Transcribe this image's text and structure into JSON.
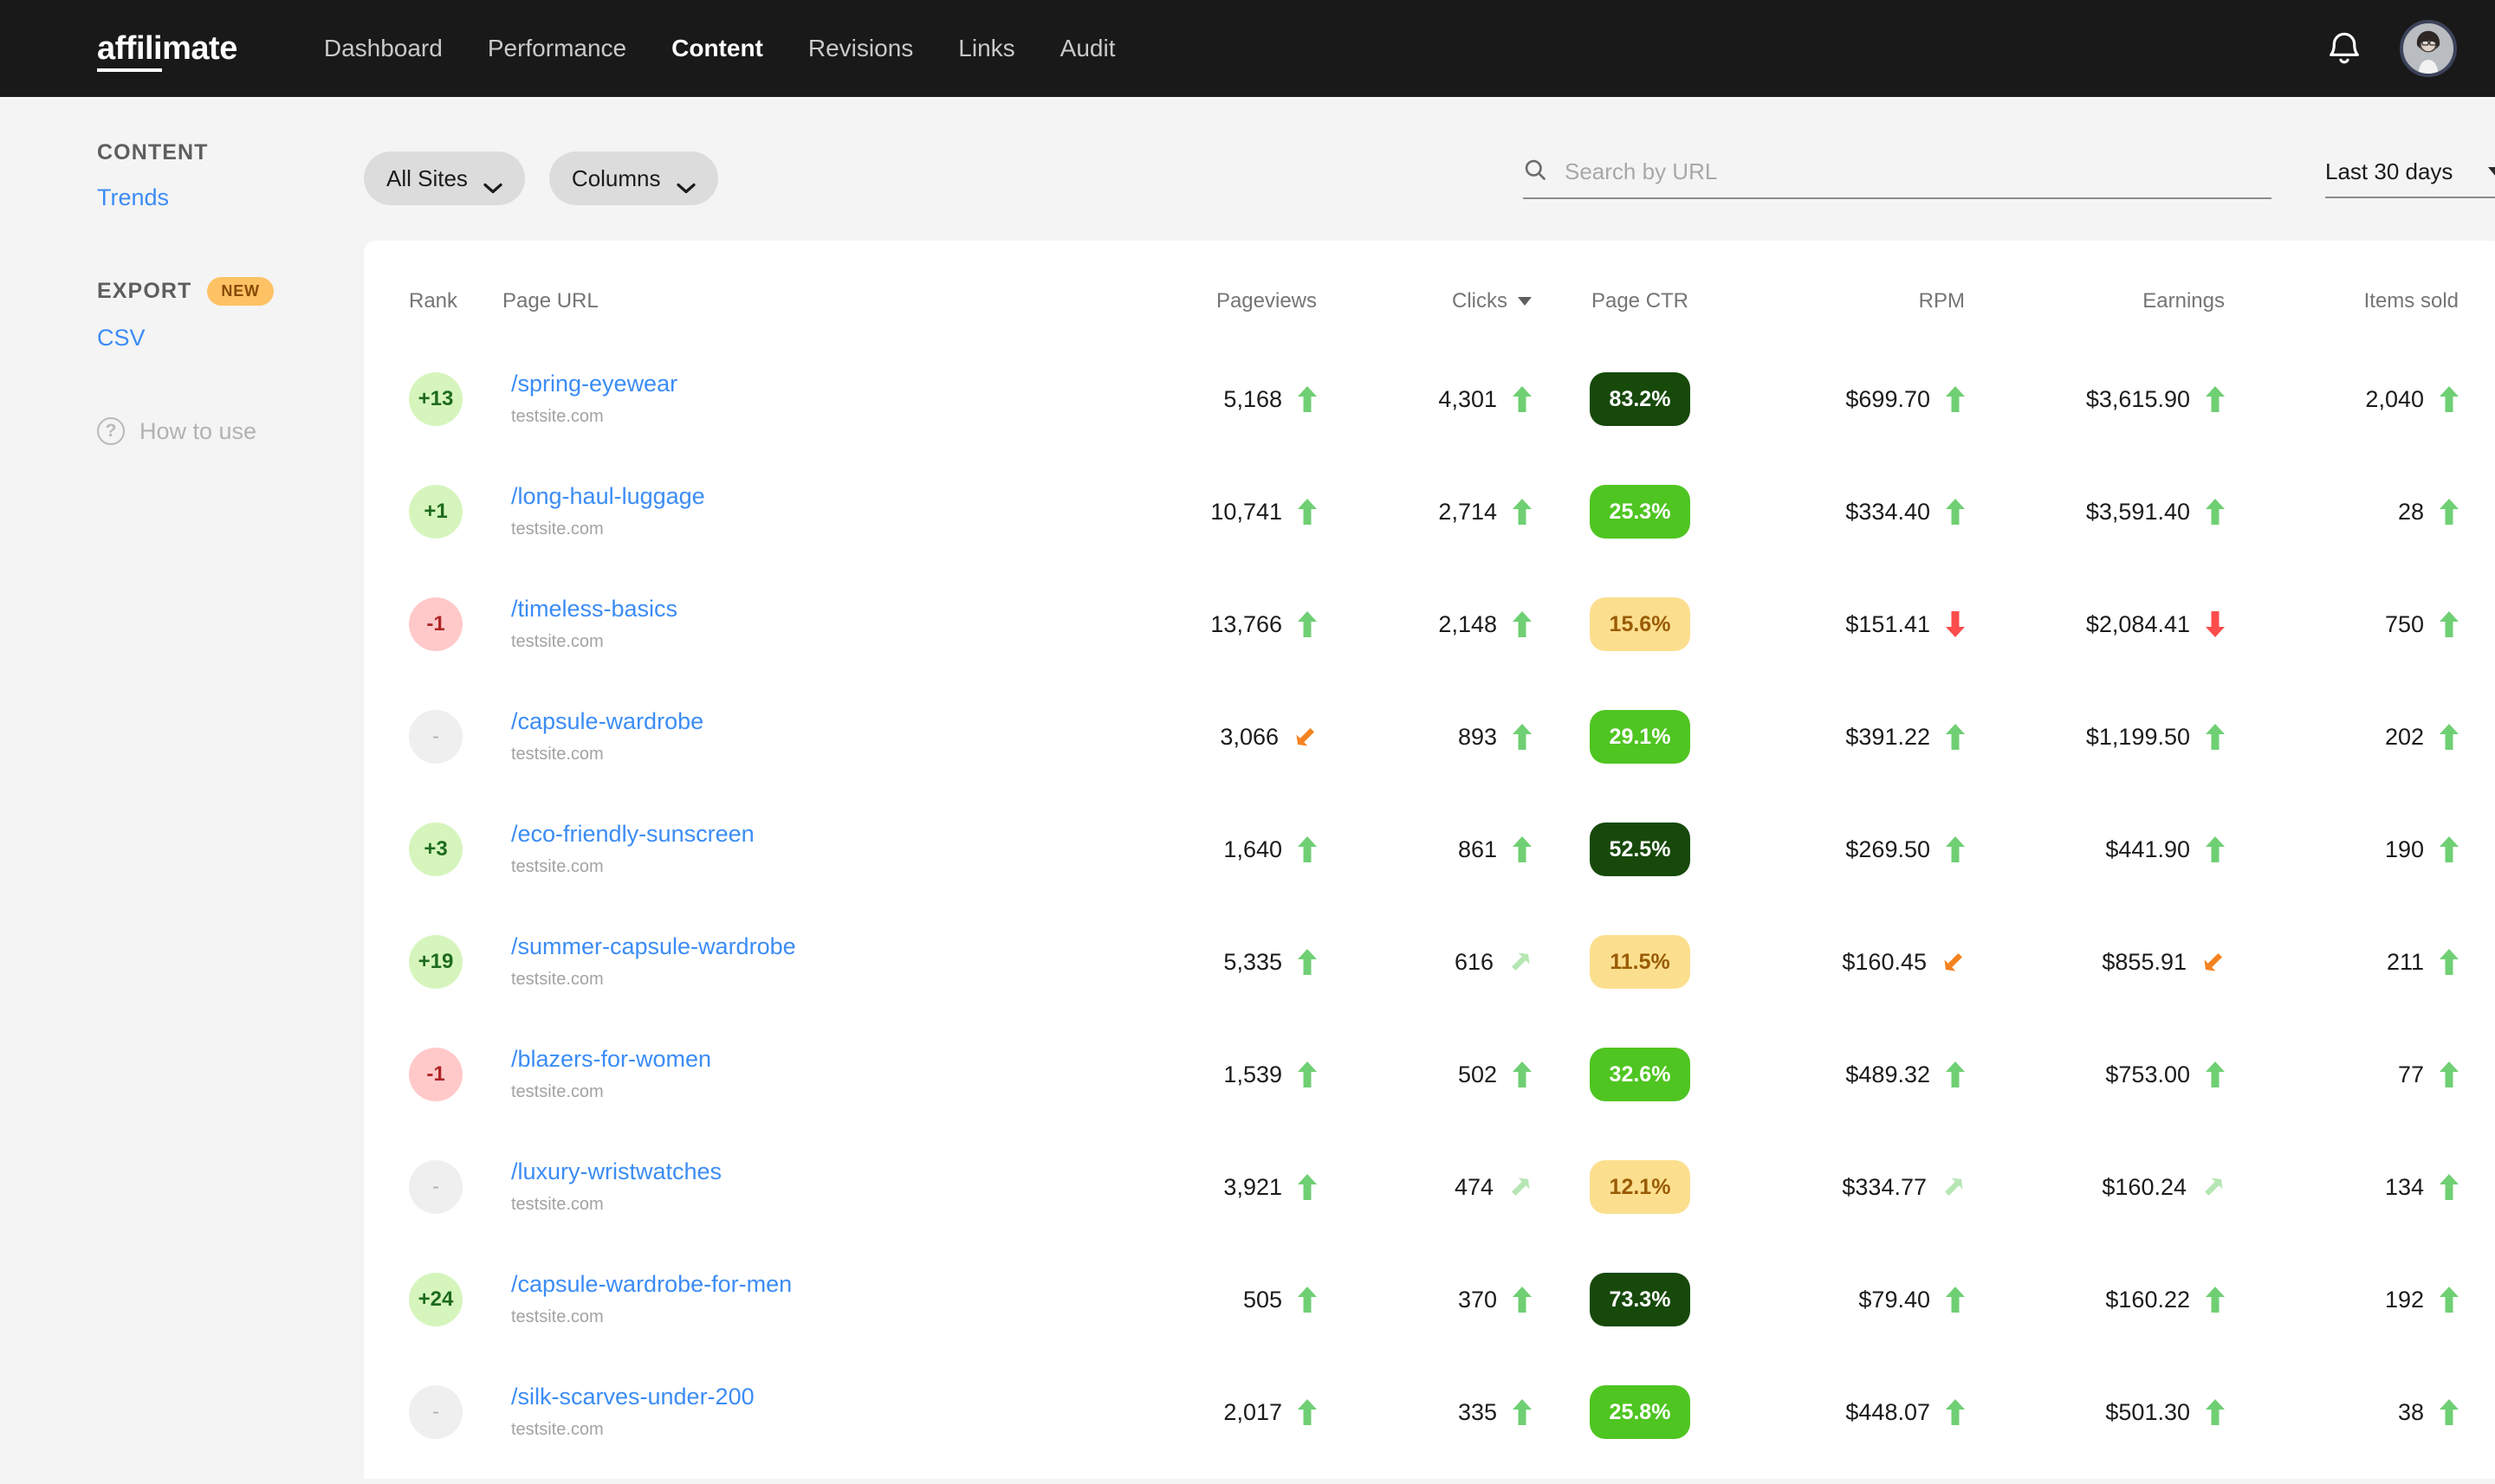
{
  "brand": {
    "name_underlined": "affili",
    "name_rest": "mate"
  },
  "nav": {
    "items": [
      {
        "label": "Dashboard",
        "active": false
      },
      {
        "label": "Performance",
        "active": false
      },
      {
        "label": "Content",
        "active": true
      },
      {
        "label": "Revisions",
        "active": false
      },
      {
        "label": "Links",
        "active": false
      },
      {
        "label": "Audit",
        "active": false
      }
    ],
    "notifications_icon": "bell-icon",
    "avatar_icon": "user-avatar"
  },
  "sidebar": {
    "section_content": "CONTENT",
    "content_links": [
      {
        "label": "Trends"
      }
    ],
    "section_export": "EXPORT",
    "export_badge": "NEW",
    "export_links": [
      {
        "label": "CSV"
      }
    ],
    "help": {
      "label": "How to use",
      "icon": "question-circle-icon"
    }
  },
  "toolbar": {
    "sites_filter": "All Sites",
    "columns_filter": "Columns",
    "search": {
      "value": "",
      "placeholder": "Search by URL",
      "icon": "search-icon"
    },
    "date_range": "Last 30 days"
  },
  "table": {
    "columns": [
      {
        "key": "rank",
        "label": "Rank",
        "sorted": false
      },
      {
        "key": "url",
        "label": "Page URL",
        "sorted": false
      },
      {
        "key": "pv",
        "label": "Pageviews",
        "sorted": false
      },
      {
        "key": "clicks",
        "label": "Clicks",
        "sorted": true
      },
      {
        "key": "ctr",
        "label": "Page CTR",
        "sorted": false
      },
      {
        "key": "rpm",
        "label": "RPM",
        "sorted": false
      },
      {
        "key": "earn",
        "label": "Earnings",
        "sorted": false
      },
      {
        "key": "items",
        "label": "Items sold",
        "sorted": false
      }
    ],
    "rows": [
      {
        "rank": "+13",
        "rank_state": "up",
        "url": "/spring-eyewear",
        "site": "testsite.com",
        "pageviews": "5,168",
        "pv_trend": "up",
        "clicks": "4,301",
        "clicks_trend": "up",
        "ctr": "83.2%",
        "ctr_level": "very-high",
        "rpm": "$699.70",
        "rpm_trend": "up",
        "earnings": "$3,615.90",
        "earn_trend": "up",
        "items": "2,040",
        "items_trend": "up"
      },
      {
        "rank": "+1",
        "rank_state": "up",
        "url": "/long-haul-luggage",
        "site": "testsite.com",
        "pageviews": "10,741",
        "pv_trend": "up",
        "clicks": "2,714",
        "clicks_trend": "up",
        "ctr": "25.3%",
        "ctr_level": "high",
        "rpm": "$334.40",
        "rpm_trend": "up",
        "earnings": "$3,591.40",
        "earn_trend": "up",
        "items": "28",
        "items_trend": "up"
      },
      {
        "rank": "-1",
        "rank_state": "down",
        "url": "/timeless-basics",
        "site": "testsite.com",
        "pageviews": "13,766",
        "pv_trend": "up",
        "clicks": "2,148",
        "clicks_trend": "up",
        "ctr": "15.6%",
        "ctr_level": "mid",
        "rpm": "$151.41",
        "rpm_trend": "down",
        "earnings": "$2,084.41",
        "earn_trend": "down",
        "items": "750",
        "items_trend": "up"
      },
      {
        "rank": "-",
        "rank_state": "flat",
        "url": "/capsule-wardrobe",
        "site": "testsite.com",
        "pageviews": "3,066",
        "pv_trend": "slight-down",
        "clicks": "893",
        "clicks_trend": "up",
        "ctr": "29.1%",
        "ctr_level": "high",
        "rpm": "$391.22",
        "rpm_trend": "up",
        "earnings": "$1,199.50",
        "earn_trend": "up",
        "items": "202",
        "items_trend": "up"
      },
      {
        "rank": "+3",
        "rank_state": "up",
        "url": "/eco-friendly-sunscreen",
        "site": "testsite.com",
        "pageviews": "1,640",
        "pv_trend": "up",
        "clicks": "861",
        "clicks_trend": "up",
        "ctr": "52.5%",
        "ctr_level": "very-high",
        "rpm": "$269.50",
        "rpm_trend": "up",
        "earnings": "$441.90",
        "earn_trend": "up",
        "items": "190",
        "items_trend": "up"
      },
      {
        "rank": "+19",
        "rank_state": "up",
        "url": "/summer-capsule-wardrobe",
        "site": "testsite.com",
        "pageviews": "5,335",
        "pv_trend": "up",
        "clicks": "616",
        "clicks_trend": "slight-up",
        "ctr": "11.5%",
        "ctr_level": "mid",
        "rpm": "$160.45",
        "rpm_trend": "slight-down",
        "earnings": "$855.91",
        "earn_trend": "slight-down",
        "items": "211",
        "items_trend": "up"
      },
      {
        "rank": "-1",
        "rank_state": "down",
        "url": "/blazers-for-women",
        "site": "testsite.com",
        "pageviews": "1,539",
        "pv_trend": "up",
        "clicks": "502",
        "clicks_trend": "up",
        "ctr": "32.6%",
        "ctr_level": "high",
        "rpm": "$489.32",
        "rpm_trend": "up",
        "earnings": "$753.00",
        "earn_trend": "up",
        "items": "77",
        "items_trend": "up"
      },
      {
        "rank": "-",
        "rank_state": "flat",
        "url": "/luxury-wristwatches",
        "site": "testsite.com",
        "pageviews": "3,921",
        "pv_trend": "up",
        "clicks": "474",
        "clicks_trend": "slight-up",
        "ctr": "12.1%",
        "ctr_level": "mid",
        "rpm": "$334.77",
        "rpm_trend": "slight-up",
        "earnings": "$160.24",
        "earn_trend": "slight-up",
        "items": "134",
        "items_trend": "up"
      },
      {
        "rank": "+24",
        "rank_state": "up",
        "url": "/capsule-wardrobe-for-men",
        "site": "testsite.com",
        "pageviews": "505",
        "pv_trend": "up",
        "clicks": "370",
        "clicks_trend": "up",
        "ctr": "73.3%",
        "ctr_level": "very-high",
        "rpm": "$79.40",
        "rpm_trend": "up",
        "earnings": "$160.22",
        "earn_trend": "up",
        "items": "192",
        "items_trend": "up"
      },
      {
        "rank": "-",
        "rank_state": "flat",
        "url": "/silk-scarves-under-200",
        "site": "testsite.com",
        "pageviews": "2,017",
        "pv_trend": "up",
        "clicks": "335",
        "clicks_trend": "up",
        "ctr": "25.8%",
        "ctr_level": "high",
        "rpm": "$448.07",
        "rpm_trend": "up",
        "earnings": "$501.30",
        "earn_trend": "up",
        "items": "38",
        "items_trend": "up"
      }
    ]
  },
  "colors": {
    "nav_bg": "#191919",
    "page_bg": "#f4f4f4",
    "link_blue": "#3b8cf5",
    "trend_up": "#6fcf73",
    "trend_down": "#fc4c4c",
    "trend_slight_down": "#f58220",
    "trend_slight_up": "#b6e6b4",
    "rank_up_bg": "#d6f5bd",
    "rank_down_bg": "#ffc9c9",
    "rank_flat_bg": "#efefef",
    "ctr_very_high": "#17490a",
    "ctr_high": "#4fc521",
    "ctr_mid": "#fcdf8e",
    "badge_new_bg": "#fcc264"
  }
}
